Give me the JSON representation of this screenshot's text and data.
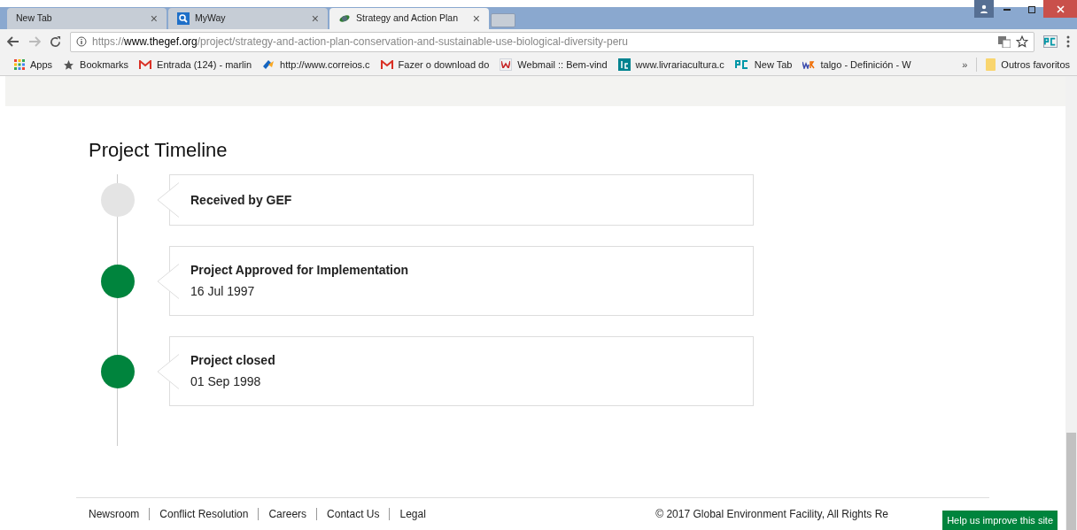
{
  "browser": {
    "tabs": [
      {
        "title": "New Tab",
        "selected": false,
        "close": "×"
      },
      {
        "title": "MyWay",
        "selected": false,
        "close": "×"
      },
      {
        "title": "Strategy and Action Plan",
        "selected": true,
        "close": "×"
      }
    ],
    "url": {
      "scheme": "https://",
      "host": "www.thegef.org",
      "path": "/project/strategy-and-action-plan-conservation-and-sustainable-use-biological-diversity-peru"
    },
    "bookmarks": [
      "Apps",
      "Bookmarks",
      "Entrada (124) - marlin",
      "http://www.correios.c",
      "Fazer o download do",
      "Webmail :: Bem-vind",
      "www.livrariacultura.c",
      "New Tab",
      "talgo - Definición - W"
    ],
    "overflow": "»",
    "other_bookmarks": "Outros favoritos"
  },
  "page": {
    "title": "Project Timeline",
    "timeline": [
      {
        "title": "Received by GEF",
        "done": false
      },
      {
        "title": "Project Approved for Implementation",
        "date": "16 Jul 1997",
        "done": true
      },
      {
        "title": "Project closed",
        "date": "01 Sep 1998",
        "done": true
      }
    ],
    "footer_links": [
      "Newsroom",
      "Conflict Resolution",
      "Careers",
      "Contact Us",
      "Legal"
    ],
    "copyright": "© 2017 Global Environment Facility, All Rights Re",
    "help_button": "Help us improve this site"
  }
}
